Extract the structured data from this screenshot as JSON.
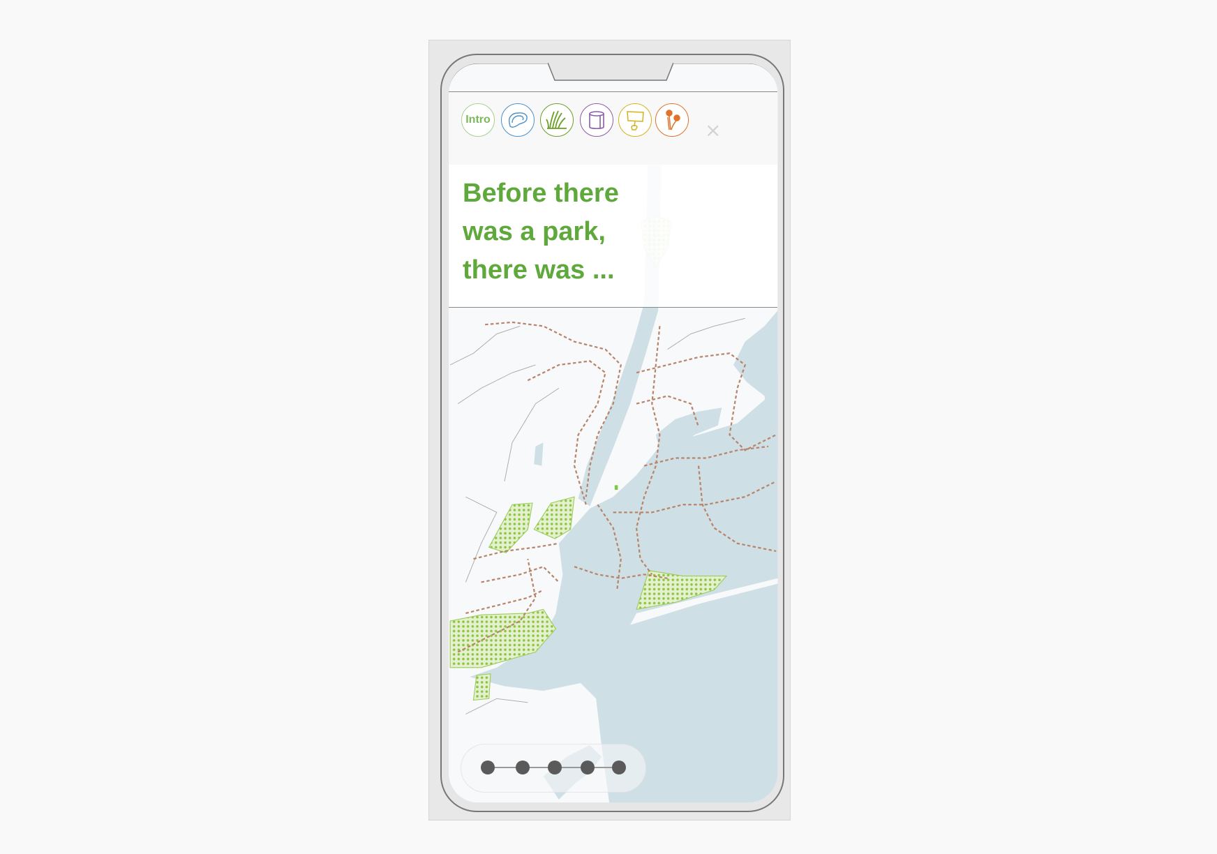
{
  "nav": {
    "items": [
      {
        "label": "Intro",
        "icon": "intro",
        "color": "#8fc271"
      },
      {
        "icon": "oyster-icon",
        "color": "#4a8fc9"
      },
      {
        "icon": "marsh-grass-icon",
        "color": "#6a9e24"
      },
      {
        "icon": "barrel-icon",
        "color": "#8e5aa8"
      },
      {
        "icon": "protest-sign-icon",
        "color": "#d4b21e"
      },
      {
        "icon": "flower-icon",
        "color": "#e0722a"
      }
    ],
    "close_label": "×"
  },
  "headline": "Before there was a park, there was ...",
  "colors": {
    "headline": "#5fa83c",
    "water": "#cfdfe6",
    "land": "#f8f9fb",
    "marsh": "#8cc63f",
    "trails": "#b8846a"
  },
  "pager": {
    "count": 5,
    "current": 1
  }
}
